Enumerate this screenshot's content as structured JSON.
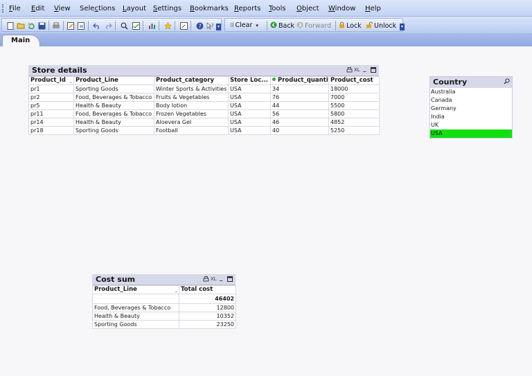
{
  "menu": [
    "File",
    "Edit",
    "View",
    "Selections",
    "Layout",
    "Settings",
    "Bookmarks",
    "Reports",
    "Tools",
    "Object",
    "Window",
    "Help"
  ],
  "menu_mnemonics": [
    "F",
    "E",
    "V",
    "c",
    "L",
    "S",
    "B",
    "R",
    "T",
    "O",
    "W",
    "H"
  ],
  "toolbar": {
    "clear_label": "Clear",
    "back_label": "Back",
    "forward_label": "Forward",
    "lock_label": "Lock",
    "unlock_label": "Unlock"
  },
  "tabs": [
    {
      "label": "Main"
    }
  ],
  "store_details": {
    "title": "Store details",
    "controls": {
      "print": "🖶",
      "xl": "XL",
      "minimize": "_",
      "maximize": "□"
    },
    "columns": [
      "Product_Id",
      "Product_Line",
      "Product_category",
      "Store Loc...",
      "Product_quantity",
      "Product_cost"
    ],
    "rows": [
      [
        "pr1",
        "Sporting Goods",
        "Winter Sports & Activities",
        "USA",
        "34",
        "18000"
      ],
      [
        "pr2",
        "Food, Beverages & Tobacco",
        "Fruits & Vegetables",
        "USA",
        "76",
        "7000"
      ],
      [
        "pr5",
        "Health & Beauty",
        "Body lotion",
        "USA",
        "44",
        "5500"
      ],
      [
        "pr11",
        "Food, Beverages & Tobacco",
        "Frozen Vegetables",
        "USA",
        "56",
        "5800"
      ],
      [
        "pr14",
        "Health & Beauty",
        "Aloevera Gel",
        "USA",
        "46",
        "4852"
      ],
      [
        "pr18",
        "Sporting Goods",
        "Football",
        "USA",
        "40",
        "5250"
      ]
    ]
  },
  "country": {
    "title": "Country",
    "items": [
      "Australia",
      "Canada",
      "Germany",
      "India",
      "UK",
      "USA"
    ],
    "selected": "USA",
    "selected_color": "#10e010"
  },
  "cost_sum": {
    "title": "Cost sum",
    "controls": {
      "print": "🖶",
      "xl": "XL",
      "minimize": "_",
      "maximize": "□"
    },
    "columns": [
      "Product_Line",
      "Total cost"
    ],
    "total": "46402",
    "rows": [
      [
        "Food, Beverages & Tobacco",
        "12800"
      ],
      [
        "Health & Beauty",
        "10352"
      ],
      [
        "Sporting Goods",
        "23250"
      ]
    ]
  }
}
